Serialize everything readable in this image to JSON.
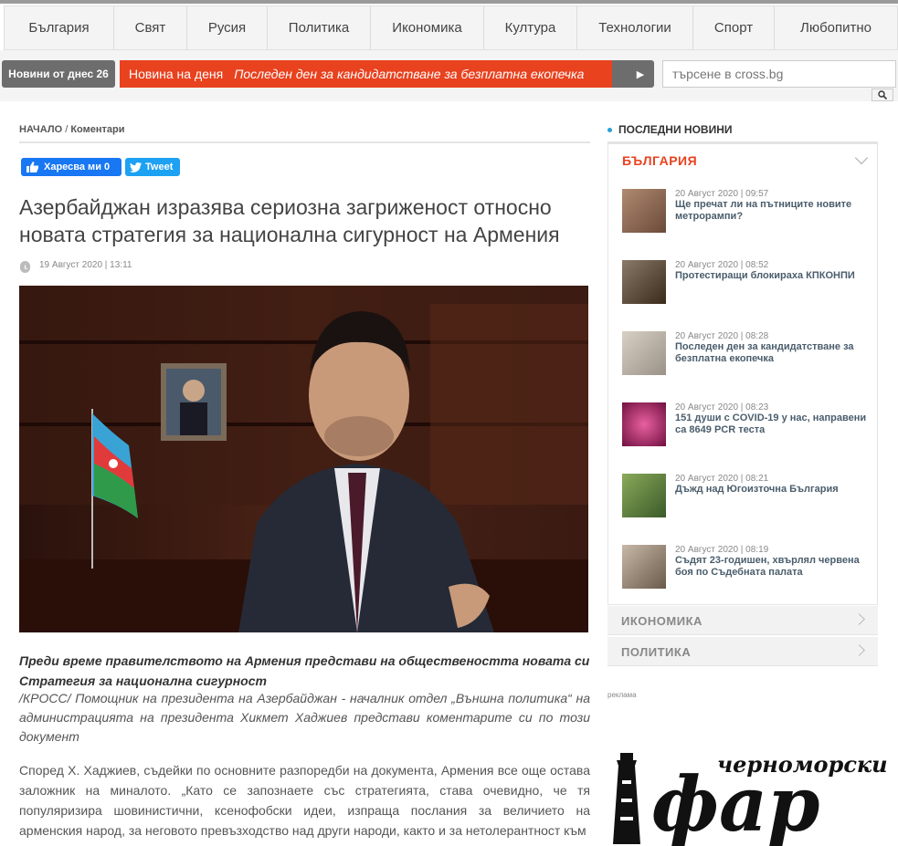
{
  "nav": {
    "items": [
      "България",
      "Свят",
      "Русия",
      "Политика",
      "Икономика",
      "Култура",
      "Технологии",
      "Спорт",
      "Любопитно"
    ]
  },
  "ticker": {
    "today_label": "Новини от днес 26",
    "label": "Новина на деня",
    "text": "Последен ден за кандидатстване за безплатна екопечка",
    "next": "▶"
  },
  "search": {
    "placeholder": "търсене в cross.bg"
  },
  "breadcrumb": {
    "home": "НАЧАЛО",
    "separator": "/",
    "section": "Коментари"
  },
  "share": {
    "facebook": "Харесва ми 0",
    "twitter": "Tweet"
  },
  "article": {
    "title": "Азербайджан изразява сериозна загриженост относно новата стратегия за национална сигурност на Армения",
    "date": "19 Август 2020 | 13:11",
    "lead": "Преди време правителството на Армения представи на обществеността новата си Стратегия за национална сигурност",
    "subtext_source": "/КРОСС/",
    "subtext": " Помощник на президента на Азербайджан - началник отдел „Външна политика“ на администрацията на президента Хикмет Хаджиев представи коментарите си по този документ",
    "body": "Според Х. Хаджиев, съдейки по основните разпоредби на документа, Армения все още остава заложник на миналото. „Като се запознаете със стратегията, става очевидно, че тя популяризира шовинистични, ксенофобски идеи, изпраща послания за величието на арменския народ, за неговото превъзходство над други народи, както и за нетолерантност към"
  },
  "sidebar": {
    "latest_title": "ПОСЛЕДНИ НОВИНИ",
    "section_title": "БЪЛГАРИЯ",
    "news": [
      {
        "date": "20 Август 2020 | 09:57",
        "title": "Ще пречат ли на пътниците новите метрорампи?",
        "thumb": "#8a6a5a"
      },
      {
        "date": "20 Август 2020 | 08:52",
        "title": "Протестиращи блокираха КПКОНПИ",
        "thumb": "#6b5a4a"
      },
      {
        "date": "20 Август 2020 | 08:28",
        "title": "Последен ден за кандидатстване за безплатна екопечка",
        "thumb": "#b9b2a6"
      },
      {
        "date": "20 Август 2020 | 08:23",
        "title": "151 души с COVID-19 у нас, направени са 8649 PCR теста",
        "thumb": "#a0306a"
      },
      {
        "date": "20 Август 2020 | 08:21",
        "title": "Дъжд над Югоизточна България",
        "thumb": "#5a7a3a"
      },
      {
        "date": "20 Август 2020 | 08:19",
        "title": "Съдят 23-годишен, хвърлял червена боя по Съдебната палата",
        "thumb": "#8a7a6a"
      }
    ],
    "categories": [
      "ИКОНОМИКА",
      "ПОЛИТИКА"
    ],
    "ad_label": "реклама",
    "ad": {
      "top": "черноморски",
      "main": "фар"
    }
  },
  "colors": {
    "accent": "#e8421f",
    "nav_bg": "#f4f4f4",
    "news_title": "#4a5d6c"
  }
}
